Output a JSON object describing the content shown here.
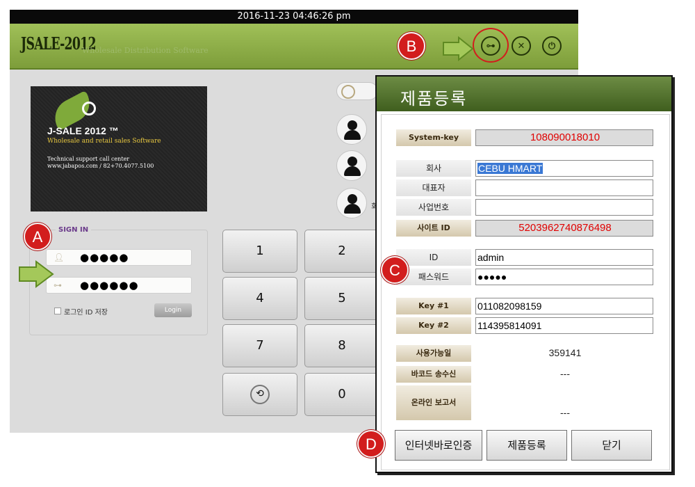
{
  "timebar": {
    "datetime": "2016-11-23 04:46:26 pm"
  },
  "header": {
    "logo": "JSALE-2012",
    "tagline": "Wholesale Distribution Software",
    "icons": [
      "key-icon",
      "settings-icon",
      "power-icon"
    ]
  },
  "splash": {
    "title": "J-SALE 2012 ™",
    "subtitle": "Wholesale and retail sales Software",
    "line1": "Technical support call center",
    "line2": "www.jabapos.com / 82+70.4077.5100"
  },
  "signin": {
    "legend": "SIGN IN",
    "user_value": "●●●●●",
    "password_value": "●●●●●●",
    "save_label": "로그인 ID 저장",
    "login_label": "Login"
  },
  "keypad": {
    "keys": [
      "1",
      "2",
      "4",
      "5",
      "7",
      "8",
      "⟲",
      "0"
    ]
  },
  "side_partial": {
    "text": "회"
  },
  "callouts": {
    "a": "A",
    "b": "B",
    "c": "C",
    "d": "D"
  },
  "dialog": {
    "title": "제품등록",
    "fields": {
      "system_key": {
        "label": "System-key",
        "value": "108090018010"
      },
      "company": {
        "label": "회사",
        "value": "CEBU HMART"
      },
      "representative": {
        "label": "대표자",
        "value": ""
      },
      "business_no": {
        "label": "사업번호",
        "value": ""
      },
      "site_id": {
        "label": "사이트 ID",
        "value": "5203962740876498"
      },
      "id": {
        "label": "ID",
        "value": "admin"
      },
      "password": {
        "label": "패스워드",
        "value": "●●●●●"
      },
      "key1": {
        "label": "Key #1",
        "value": "011082098159"
      },
      "key2": {
        "label": "Key #2",
        "value": "114395814091"
      },
      "available_days": {
        "label": "사용가능일",
        "value": "359141"
      },
      "barcode_transfer": {
        "label": "바코드 송수신",
        "value": "---"
      },
      "online_report": {
        "label": "온라인 보고서",
        "value": "---"
      }
    },
    "buttons": {
      "internet_auth": "인터넷바로인증",
      "register": "제품등록",
      "close": "닫기"
    }
  },
  "colors": {
    "header_green": "#7d9d3a",
    "dialog_header": "#4e6e2a",
    "callout_red": "#d21d1d",
    "value_red": "#e00000"
  }
}
